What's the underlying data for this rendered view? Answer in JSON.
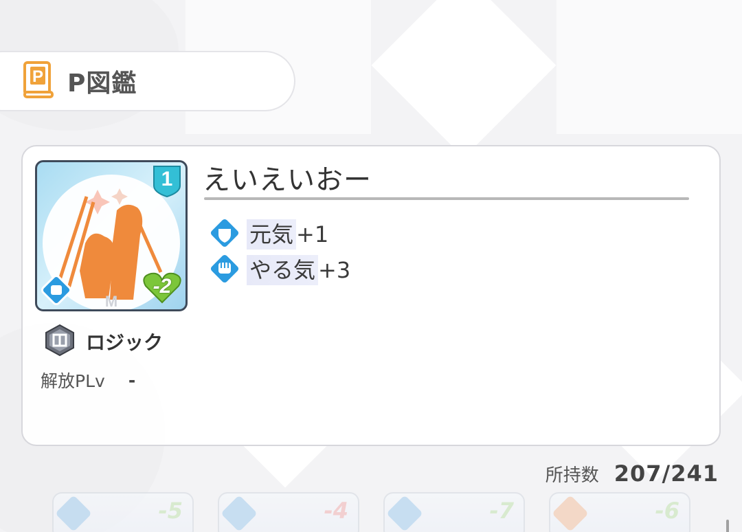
{
  "header": {
    "title": "P図鑑",
    "icon": "book-p-icon",
    "icon_color": "#f0a23a"
  },
  "card": {
    "level_badge": "1",
    "cost_badge": "-2",
    "name": "えいえいおー",
    "effects": [
      {
        "icon": "shield-hand-icon",
        "label": "元気",
        "value": "+1"
      },
      {
        "icon": "fist-icon",
        "label": "やる気",
        "value": "+3"
      }
    ],
    "plan": {
      "icon": "logic-plan-icon",
      "label": "ロジック"
    },
    "unlock": {
      "label": "解放PLv",
      "value": "-"
    }
  },
  "owned": {
    "label": "所持数",
    "value": "207/241"
  },
  "peek_cards": [
    {
      "badge": "-5"
    },
    {
      "badge": "-4"
    },
    {
      "badge": "-7"
    },
    {
      "badge": "-6"
    }
  ],
  "colors": {
    "accent_blue": "#2b9be0",
    "badge_green": "#7cc63a",
    "art_orange": "#ef8a3c"
  }
}
